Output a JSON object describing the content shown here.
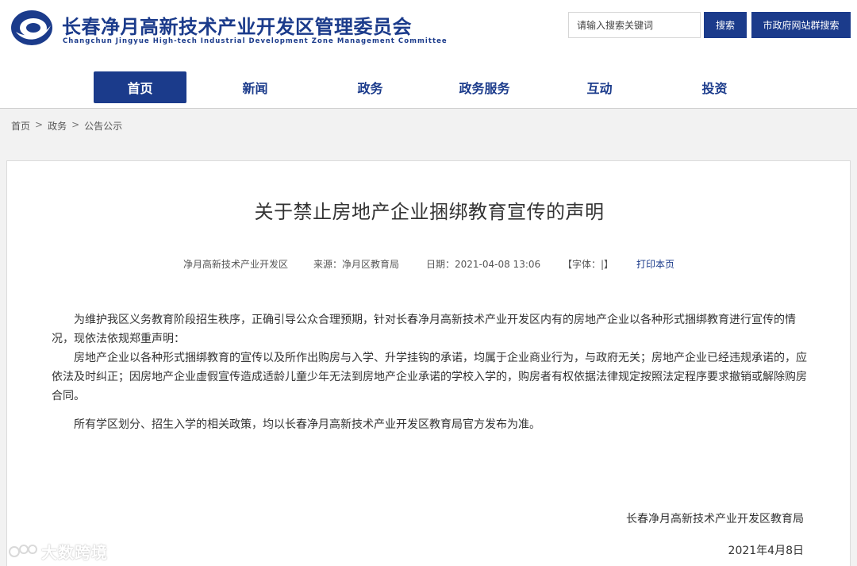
{
  "header": {
    "title": "长春净月高新技术产业开发区管理委员会",
    "subtitle": "Changchun Jingyue High-tech Industrial Development Zone Management Committee",
    "search_placeholder": "请输入搜索关键词",
    "search_button": "搜索",
    "group_search_button": "市政府网站群搜索",
    "brand_color": "#1b3b8b"
  },
  "nav": {
    "items": [
      {
        "label": "首页",
        "active": true
      },
      {
        "label": "新闻",
        "active": false
      },
      {
        "label": "政务",
        "active": false
      },
      {
        "label": "政务服务",
        "active": false
      },
      {
        "label": "互动",
        "active": false
      },
      {
        "label": "投资",
        "active": false
      }
    ]
  },
  "breadcrumb": {
    "items": [
      "首页",
      "政务",
      "公告公示"
    ],
    "separator": ">"
  },
  "article": {
    "title": "关于禁止房地产企业捆绑教育宣传的声明",
    "meta": {
      "org": "净月高新技术产业开发区",
      "source": "来源：净月区教育局",
      "date": "日期：2021-04-08 13:06",
      "font_size": "【字体：|】",
      "print": "打印本页"
    },
    "paragraphs": [
      "为维护我区义务教育阶段招生秩序，正确引导公众合理预期，针对长春净月高新技术产业开发区内有的房地产企业以各种形式捆绑教育进行宣传的情况，现依法依规郑重声明：",
      "房地产企业以各种形式捆绑教育的宣传以及所作出购房与入学、升学挂钩的承诺，均属于企业商业行为，与政府无关；房地产企业已经违规承诺的，应依法及时纠正；因房地产企业虚假宣传造成适龄儿童少年无法到房地产企业承诺的学校入学的，购房者有权依据法律规定按照法定程序要求撤销或解除购房合同。",
      "所有学区划分、招生入学的相关政策，均以长春净月高新技术产业开发区教育局官方发布为准。"
    ],
    "signature": "长春净月高新技术产业开发区教育局",
    "sign_date": "2021年4月8日"
  },
  "watermark": {
    "text": "大数跨境"
  }
}
